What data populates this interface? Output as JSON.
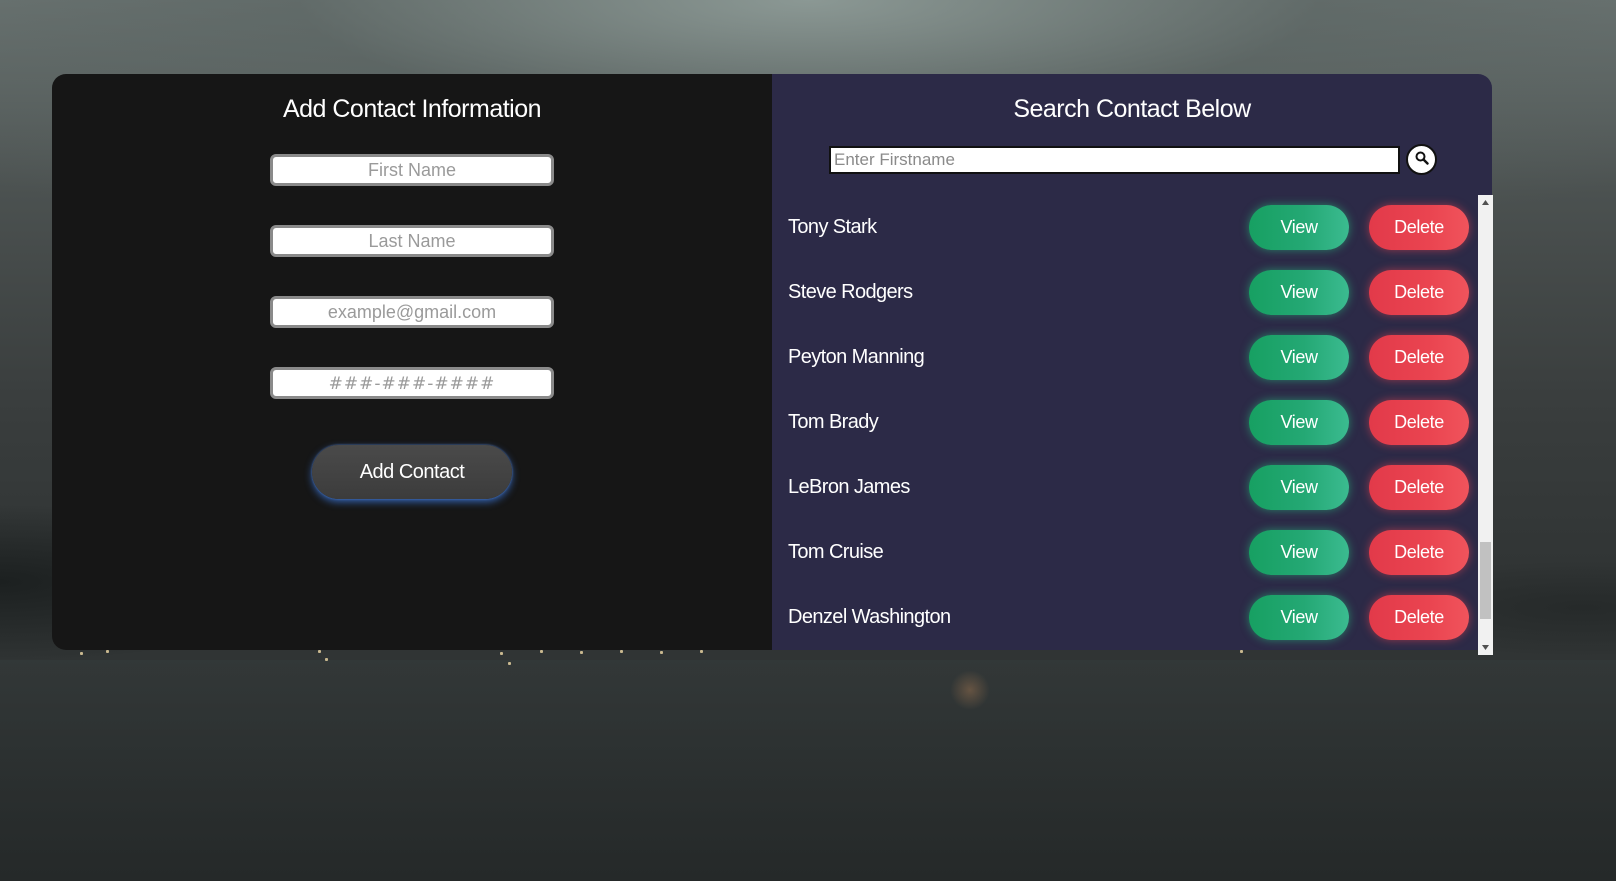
{
  "add_panel": {
    "title": "Add Contact Information",
    "first_name_placeholder": "First Name",
    "last_name_placeholder": "Last Name",
    "email_placeholder": "example@gmail.com",
    "phone_placeholder": "###-###-####",
    "add_button_label": "Add Contact"
  },
  "search_panel": {
    "title": "Search Contact Below",
    "search_placeholder": "Enter Firstname",
    "search_icon": "search-icon"
  },
  "contacts": [
    {
      "name": "Tony Stark",
      "view_label": "View",
      "delete_label": "Delete"
    },
    {
      "name": "Steve Rodgers",
      "view_label": "View",
      "delete_label": "Delete"
    },
    {
      "name": "Peyton Manning",
      "view_label": "View",
      "delete_label": "Delete"
    },
    {
      "name": "Tom Brady",
      "view_label": "View",
      "delete_label": "Delete"
    },
    {
      "name": "LeBron James",
      "view_label": "View",
      "delete_label": "Delete"
    },
    {
      "name": "Tom Cruise",
      "view_label": "View",
      "delete_label": "Delete"
    },
    {
      "name": "Denzel Washington",
      "view_label": "View",
      "delete_label": "Delete"
    }
  ],
  "colors": {
    "left_panel_bg": "#161616",
    "right_panel_bg": "#2c2a47",
    "view_button": "#1fa46a",
    "delete_button": "#e8404d",
    "add_button_glow": "#3c78dc"
  }
}
